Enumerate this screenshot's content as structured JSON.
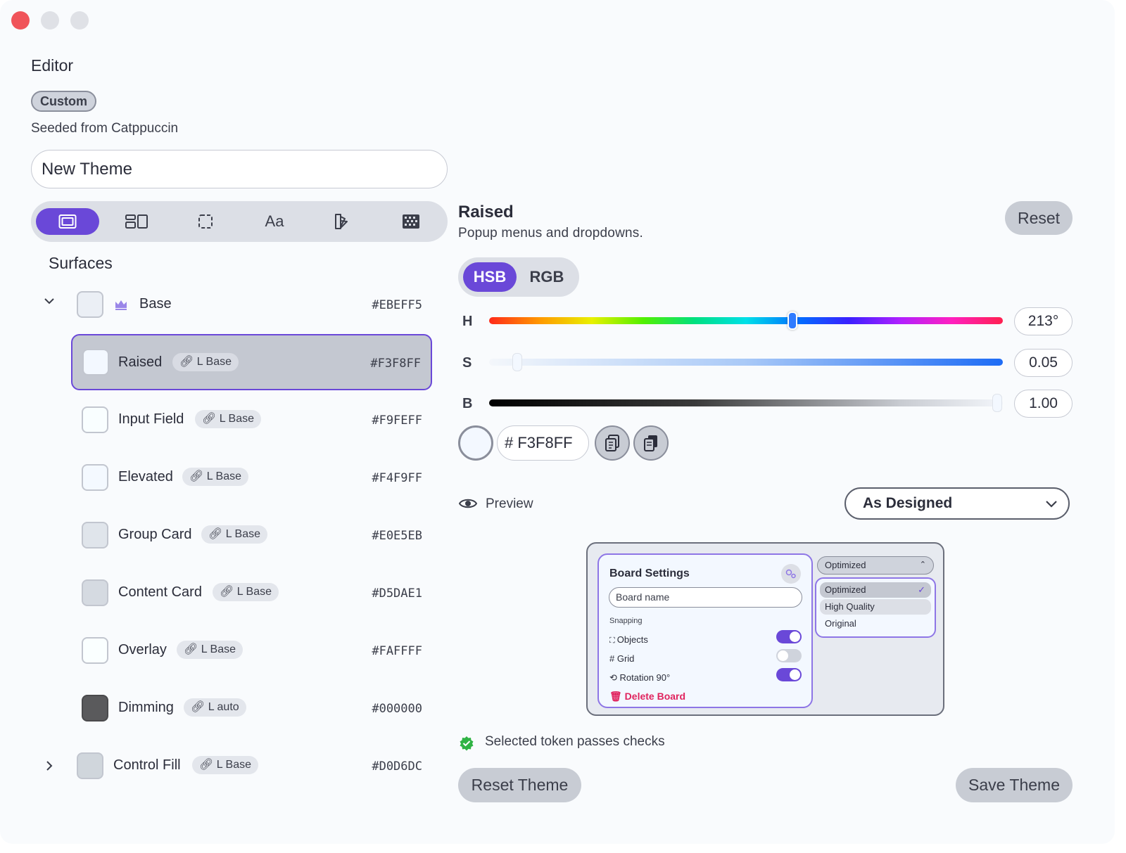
{
  "window": {
    "controls": [
      "close",
      "minimize",
      "zoom"
    ]
  },
  "editor": {
    "title": "Editor",
    "badge": "Custom",
    "seeded": "Seeded from Catppuccin",
    "theme_name": "New Theme"
  },
  "category_tabs": [
    {
      "icon": "surface-icon",
      "active": true
    },
    {
      "icon": "layout-icon"
    },
    {
      "icon": "border-icon"
    },
    {
      "label": "Aa",
      "icon": "typography-icon"
    },
    {
      "icon": "palette-icon"
    },
    {
      "icon": "pattern-icon"
    }
  ],
  "surfaces": {
    "title": "Surfaces",
    "base": {
      "label": "Base",
      "hex": "#EBEFF5",
      "color": "#EBEFF5",
      "crown_icon": "crown-icon"
    },
    "items": [
      {
        "label": "Raised",
        "link": "L Base",
        "hex": "#F3F8FF",
        "color": "#F3F8FF",
        "selected": true
      },
      {
        "label": "Input Field",
        "link": "L Base",
        "hex": "#F9FEFF",
        "color": "#F9FEFF"
      },
      {
        "label": "Elevated",
        "link": "L Base",
        "hex": "#F4F9FF",
        "color": "#F4F9FF"
      },
      {
        "label": "Group Card",
        "link": "L Base",
        "hex": "#E0E5EB",
        "color": "#E0E5EB"
      },
      {
        "label": "Content Card",
        "link": "L Base",
        "hex": "#D5DAE1",
        "color": "#D5DAE1"
      },
      {
        "label": "Overlay",
        "link": "L Base",
        "hex": "#FAFFFF",
        "color": "#FAFFFF"
      },
      {
        "label": "Dimming",
        "link": "L auto",
        "hex": "#000000",
        "color": "#5a5a5c"
      }
    ],
    "control_fill": {
      "label": "Control Fill",
      "link": "L Base",
      "hex": "#D0D6DC",
      "color": "#D0D6DC"
    }
  },
  "detail": {
    "title": "Raised",
    "subtitle": "Popup menus and dropdowns.",
    "reset_label": "Reset",
    "modes": {
      "hsb": "HSB",
      "rgb": "RGB",
      "active": "HSB"
    },
    "channels": {
      "h": {
        "label": "H",
        "value": "213°",
        "level": 0.59
      },
      "s": {
        "label": "S",
        "value": "0.05",
        "level": 0.05
      },
      "b": {
        "label": "B",
        "value": "1.00",
        "level": 1.0
      }
    },
    "hex_value": "# F3F8FF",
    "preview_label": "Preview",
    "preview_mode": "As Designed"
  },
  "preview_card": {
    "title": "Board Settings",
    "input_placeholder": "Board name",
    "section": "Snapping",
    "options": [
      {
        "label": "Objects",
        "icon": "bracket-icon",
        "on": true
      },
      {
        "label": "Grid",
        "icon": "hash-icon",
        "on": false
      },
      {
        "label": "Rotation 90°",
        "icon": "rotate-icon",
        "on": true
      }
    ],
    "delete_label": "Delete Board",
    "dropdown_value": "Optimized",
    "menu_items": [
      "Optimized",
      "High Quality",
      "Original"
    ]
  },
  "status": {
    "text": "Selected token passes checks"
  },
  "actions": {
    "reset_theme": "Reset Theme",
    "save_theme": "Save Theme"
  },
  "colors": {
    "accent": "#6a48d8",
    "danger": "#e0245e",
    "success": "#2fb344",
    "close": "#f0545a"
  }
}
